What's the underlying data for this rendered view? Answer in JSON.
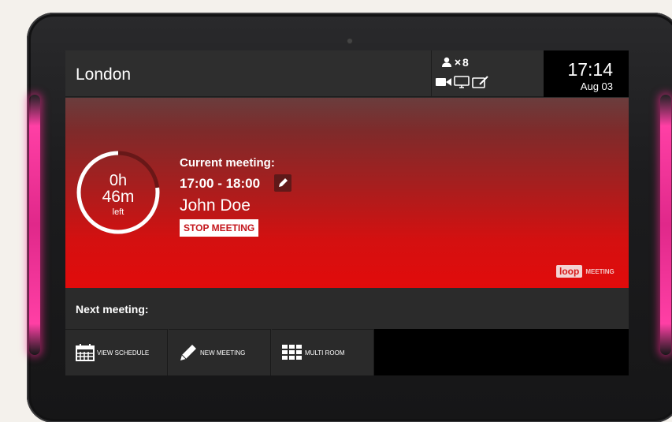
{
  "room": {
    "name": "London"
  },
  "capacity": {
    "count": "8"
  },
  "equipment": {
    "icons": [
      "camera-icon",
      "monitor-icon",
      "whiteboard-icon"
    ]
  },
  "clock": {
    "time": "17:14",
    "date": "Aug 03"
  },
  "current_meeting": {
    "label": "Current meeting:",
    "time_range": "17:00 - 18:00",
    "organizer": "John Doe",
    "stop_label": "STOP MEETING",
    "remaining_hours": "0h",
    "remaining_minutes": "46m",
    "remaining_suffix": "left",
    "remaining_fraction": 0.77
  },
  "brand": {
    "logo": "loop",
    "text": "MEETING"
  },
  "next_meeting": {
    "label": "Next meeting:"
  },
  "nav": {
    "view_schedule": "VIEW SCHEDULE",
    "new_meeting": "NEW MEETING",
    "multi_room": "MULTI ROOM"
  },
  "colors": {
    "accent_red": "#e10b0b",
    "header_bg": "#2e2e2e",
    "clock_bg": "#000000"
  }
}
